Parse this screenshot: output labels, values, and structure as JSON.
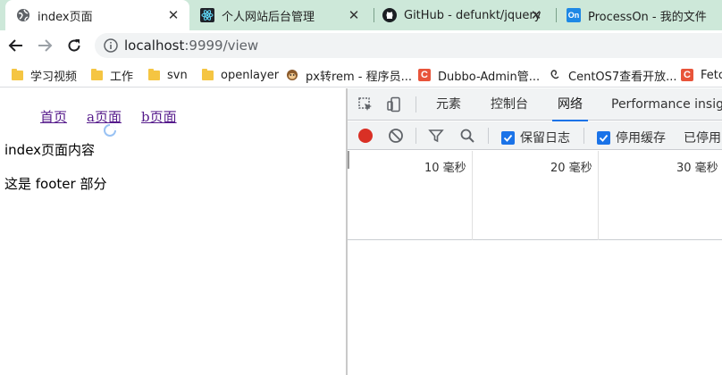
{
  "browser": {
    "tabs": [
      {
        "title": "index页面",
        "icon": "globe-icon",
        "active": true
      },
      {
        "title": "个人网站后台管理",
        "icon": "react-icon"
      },
      {
        "title": "GitHub - defunkt/jquery",
        "icon": "github-icon"
      },
      {
        "title": "ProcessOn - 我的文件",
        "icon": "processon-icon"
      }
    ],
    "address": {
      "host": "localhost",
      "rest": ":9999/view"
    },
    "bookmarks": [
      {
        "label": "学习视频",
        "icon": "folder-icon"
      },
      {
        "label": "工作",
        "icon": "folder-icon"
      },
      {
        "label": "svn",
        "icon": "folder-icon"
      },
      {
        "label": "openlayer",
        "icon": "folder-icon"
      },
      {
        "label": "px转rem - 程序员...",
        "icon": "monkey-icon"
      },
      {
        "label": "Dubbo-Admin管...",
        "icon": "csdn-icon"
      },
      {
        "label": "CentOS7查看开放...",
        "icon": "spiral-icon"
      },
      {
        "label": "Fetc",
        "icon": "csdn-icon"
      }
    ],
    "csdn_letter": "C",
    "processon_letters": "On"
  },
  "page": {
    "nav": [
      "首页",
      "a页面",
      "b页面"
    ],
    "content": "index页面内容",
    "footer": "这是 footer 部分"
  },
  "devtools": {
    "tabs": [
      "元素",
      "控制台",
      "网络",
      "Performance insigh"
    ],
    "active_tab": "网络",
    "toolbar": {
      "preserve_log": "保留日志",
      "disable_cache": "停用缓存",
      "throttling": "已停用"
    },
    "ticks": [
      "10 毫秒",
      "20 毫秒",
      "30 毫秒"
    ]
  },
  "colors": {
    "tab_strip": "#cde8d9",
    "link_visited": "#551a8b",
    "record_red": "#d93025",
    "accent_blue": "#1a73e8"
  }
}
